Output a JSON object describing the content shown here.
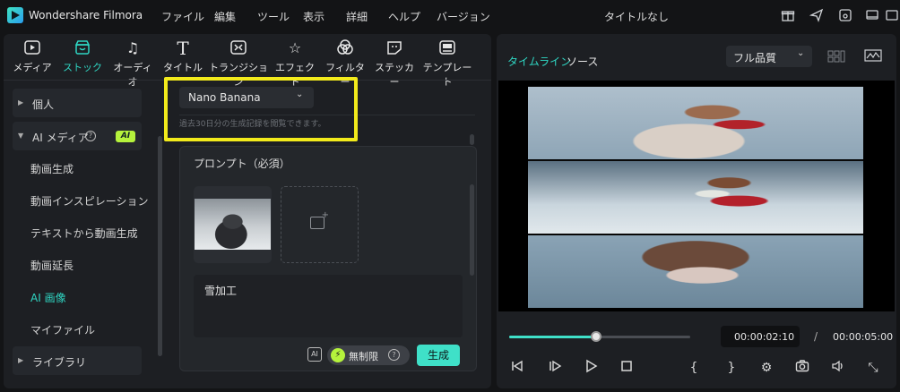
{
  "app": {
    "name": "Wondershare Filmora",
    "window_title": "タイトルなし"
  },
  "menu": [
    "ファイル",
    "編集",
    "ツール",
    "表示",
    "詳細",
    "ヘルプ",
    "バージョン"
  ],
  "title_icons": [
    "gift-icon",
    "send-icon",
    "save-icon",
    "monitor-icon",
    "fullscreen-icon"
  ],
  "media_tabs": [
    {
      "label": "メディア",
      "icon": "media-icon",
      "active": false
    },
    {
      "label": "ストック",
      "icon": "stock-icon",
      "active": true
    },
    {
      "label": "オーディオ",
      "icon": "music-note-icon",
      "active": false
    },
    {
      "label": "タイトル",
      "icon": "title-t-icon",
      "active": false
    },
    {
      "label": "トランジション",
      "icon": "transition-icon",
      "active": false
    },
    {
      "label": "エフェクト",
      "icon": "effect-star-icon",
      "active": false
    },
    {
      "label": "フィルター",
      "icon": "filter-icon",
      "active": false
    },
    {
      "label": "ステッカー",
      "icon": "sticker-icon",
      "active": false
    },
    {
      "label": "テンプレート",
      "icon": "template-icon",
      "active": false
    }
  ],
  "sidebar": {
    "personal": "個人",
    "ai_media": "AI メディア",
    "ai_badge": "AI",
    "ai_items": [
      {
        "label": "動画生成",
        "active": false
      },
      {
        "label": "動画インスピレーション",
        "active": false
      },
      {
        "label": "テキストから動画生成",
        "active": false
      },
      {
        "label": "動画延長",
        "active": false
      },
      {
        "label": "AI 画像",
        "active": true
      },
      {
        "label": "マイファイル",
        "active": false
      }
    ],
    "library": "ライブラリ"
  },
  "generator": {
    "model": "Nano Banana",
    "history_note": "過去30日分の生成記録を閲覧できます。",
    "prompt_title": "プロンプト（必須）",
    "prompt_text": "雪加工",
    "unlimited_label": "無制限",
    "generate_label": "生成"
  },
  "preview": {
    "tab_timeline": "タイムライン",
    "tab_source": "ソース",
    "quality": "フル品質",
    "current_time": "00:00:02:10",
    "separator": "/",
    "total_time": "00:00:05:00",
    "progress": 0.48
  },
  "colors": {
    "accent": "#2fd6c3",
    "highlight": "#f2ea1b",
    "ai_badge": "#b5f23c"
  }
}
